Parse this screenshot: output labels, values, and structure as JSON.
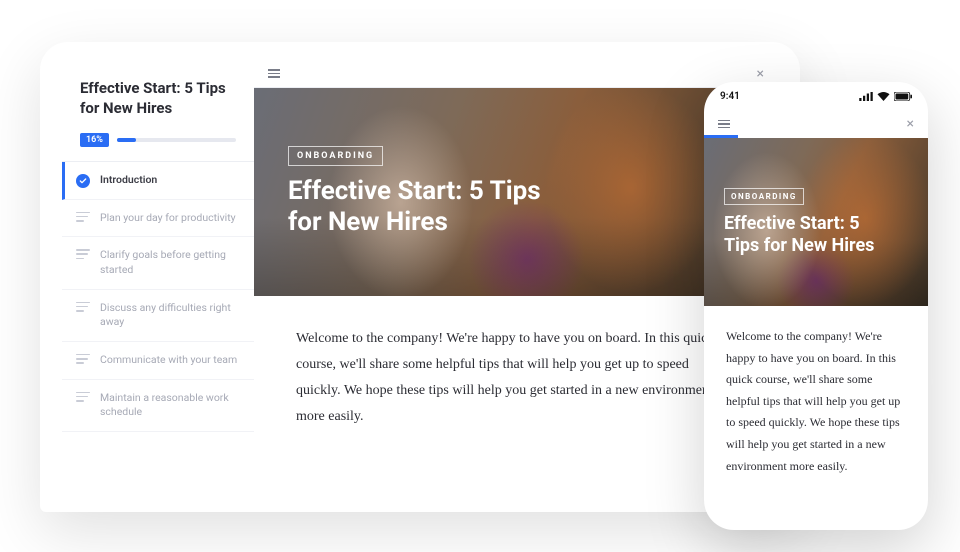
{
  "course": {
    "title": "Effective Start: 5 Tips for New Hires",
    "progress_label": "16%",
    "progress_pct": 16
  },
  "sidebar": {
    "items": [
      {
        "label": "Introduction",
        "completed": true
      },
      {
        "label": "Plan your day for productivity",
        "completed": false
      },
      {
        "label": "Clarify goals before getting started",
        "completed": false
      },
      {
        "label": "Discuss any difficulties right away",
        "completed": false
      },
      {
        "label": "Communicate with your team",
        "completed": false
      },
      {
        "label": "Maintain a reasonable work schedule",
        "completed": false
      }
    ]
  },
  "hero": {
    "tag": "ONBOARDING",
    "title": "Effective Start: 5 Tips for New Hires"
  },
  "body": {
    "intro": "Welcome to the company! We're happy to have you on board. In this quick course, we'll share some helpful tips that will help you get up to speed quickly. We hope these tips will help you get started in a new environment more easily."
  },
  "phone": {
    "time": "9:41",
    "hero_tag": "ONBOARDING",
    "hero_title": "Effective Start: 5 Tips for New Hires",
    "body": "Welcome to the company! We're happy to have you on board. In this quick course, we'll share some helpful tips that will help you get up to speed quickly. We hope these tips will help you get started in a new environment more easily."
  }
}
